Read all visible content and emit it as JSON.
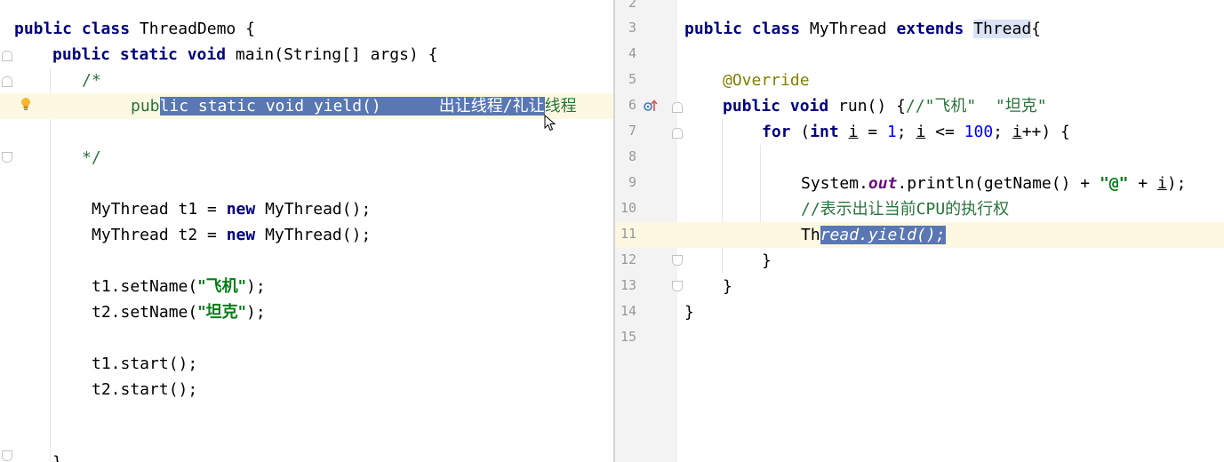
{
  "left_editor": {
    "lines": [
      {
        "id": "l1",
        "parts": [
          [
            "public class ",
            "kw"
          ],
          [
            "ThreadDemo {",
            ""
          ]
        ]
      },
      {
        "id": "l2",
        "parts": [
          [
            "public static void ",
            "kw"
          ],
          [
            "main(String[] args) {",
            ""
          ]
        ]
      },
      {
        "id": "l3",
        "parts": [
          [
            "/*",
            "cm"
          ]
        ]
      },
      {
        "id": "l4",
        "before": "pub",
        "selected": "lic static void yield()      出让线程/礼让",
        "after": "线程"
      },
      {
        "id": "l5",
        "parts": []
      },
      {
        "id": "l6",
        "parts": [
          [
            "*/",
            "cm"
          ]
        ]
      },
      {
        "id": "l7",
        "parts": []
      },
      {
        "id": "l8",
        "parts": [
          [
            "MyThread t1 = ",
            ""
          ],
          [
            "new ",
            "kw"
          ],
          [
            "MyThread();",
            ""
          ]
        ]
      },
      {
        "id": "l9",
        "parts": [
          [
            "MyThread t2 = ",
            ""
          ],
          [
            "new ",
            "kw"
          ],
          [
            "MyThread();",
            ""
          ]
        ]
      },
      {
        "id": "l10",
        "parts": []
      },
      {
        "id": "l11",
        "parts": [
          [
            "t1.setName(",
            ""
          ],
          [
            "\"飞机\"",
            "str"
          ],
          [
            ");",
            ""
          ]
        ]
      },
      {
        "id": "l12",
        "parts": [
          [
            "t2.setName(",
            ""
          ],
          [
            "\"坦克\"",
            "str"
          ],
          [
            ");",
            ""
          ]
        ]
      },
      {
        "id": "l13",
        "parts": []
      },
      {
        "id": "l14",
        "parts": [
          [
            "t1.start();",
            ""
          ]
        ]
      },
      {
        "id": "l15",
        "parts": [
          [
            "t2.start();",
            ""
          ]
        ]
      },
      {
        "id": "l16",
        "parts": []
      },
      {
        "id": "l17",
        "parts": []
      },
      {
        "id": "l18",
        "parts": [
          [
            "}",
            ""
          ]
        ]
      }
    ]
  },
  "right_editor": {
    "lines": [
      {
        "num": "2",
        "parts": []
      },
      {
        "num": "3",
        "parts": [
          [
            "public class ",
            "kw"
          ],
          [
            "MyThread ",
            ""
          ],
          [
            "extends ",
            "kw"
          ],
          [
            "Thread",
            "hl"
          ],
          [
            "{",
            ""
          ]
        ]
      },
      {
        "num": "4",
        "parts": []
      },
      {
        "num": "5",
        "parts": [
          [
            "@Override",
            "ann"
          ]
        ]
      },
      {
        "num": "6",
        "parts": [
          [
            "public void ",
            "kw"
          ],
          [
            "run() {",
            ""
          ],
          [
            "//\"飞机\"  \"坦克\"",
            "cm"
          ]
        ]
      },
      {
        "num": "7",
        "parts": [
          [
            "for ",
            "kw"
          ],
          [
            "(",
            ""
          ],
          [
            "int ",
            "kw"
          ],
          [
            "i",
            "ul"
          ],
          [
            " = ",
            ""
          ],
          [
            "1",
            "num"
          ],
          [
            "; ",
            ""
          ],
          [
            "i",
            "ul"
          ],
          [
            " <= ",
            ""
          ],
          [
            "100",
            "num"
          ],
          [
            "; ",
            ""
          ],
          [
            "i",
            "ul"
          ],
          [
            "++) {",
            ""
          ]
        ]
      },
      {
        "num": "8",
        "parts": []
      },
      {
        "num": "9",
        "parts": [
          [
            "System.",
            ""
          ],
          [
            "out",
            "fld"
          ],
          [
            ".println(getName() + ",
            ""
          ],
          [
            "\"@\"",
            "str"
          ],
          [
            " + ",
            ""
          ],
          [
            "i",
            "ul"
          ],
          [
            ");",
            ""
          ]
        ]
      },
      {
        "num": "10",
        "parts": [
          [
            "//表示出让当前CPU的执行权",
            "cm"
          ]
        ]
      },
      {
        "num": "11",
        "before": "Th",
        "selected": "read.yield();",
        "after": ""
      },
      {
        "num": "12",
        "parts": [
          [
            "}",
            ""
          ]
        ]
      },
      {
        "num": "13",
        "parts": [
          [
            "}",
            ""
          ]
        ]
      },
      {
        "num": "14",
        "parts": [
          [
            "}",
            ""
          ]
        ]
      },
      {
        "num": "15",
        "parts": []
      }
    ]
  },
  "colors": {
    "keyword": "#000080",
    "comment": "#29733b",
    "annotation": "#808000",
    "number": "#0000ff",
    "string": "#067d17",
    "selection": "#5977b3",
    "caret_row": "#fdf8e1"
  },
  "icons": [
    "intention-bulb-icon",
    "override-method-icon",
    "text-cursor-icon"
  ]
}
